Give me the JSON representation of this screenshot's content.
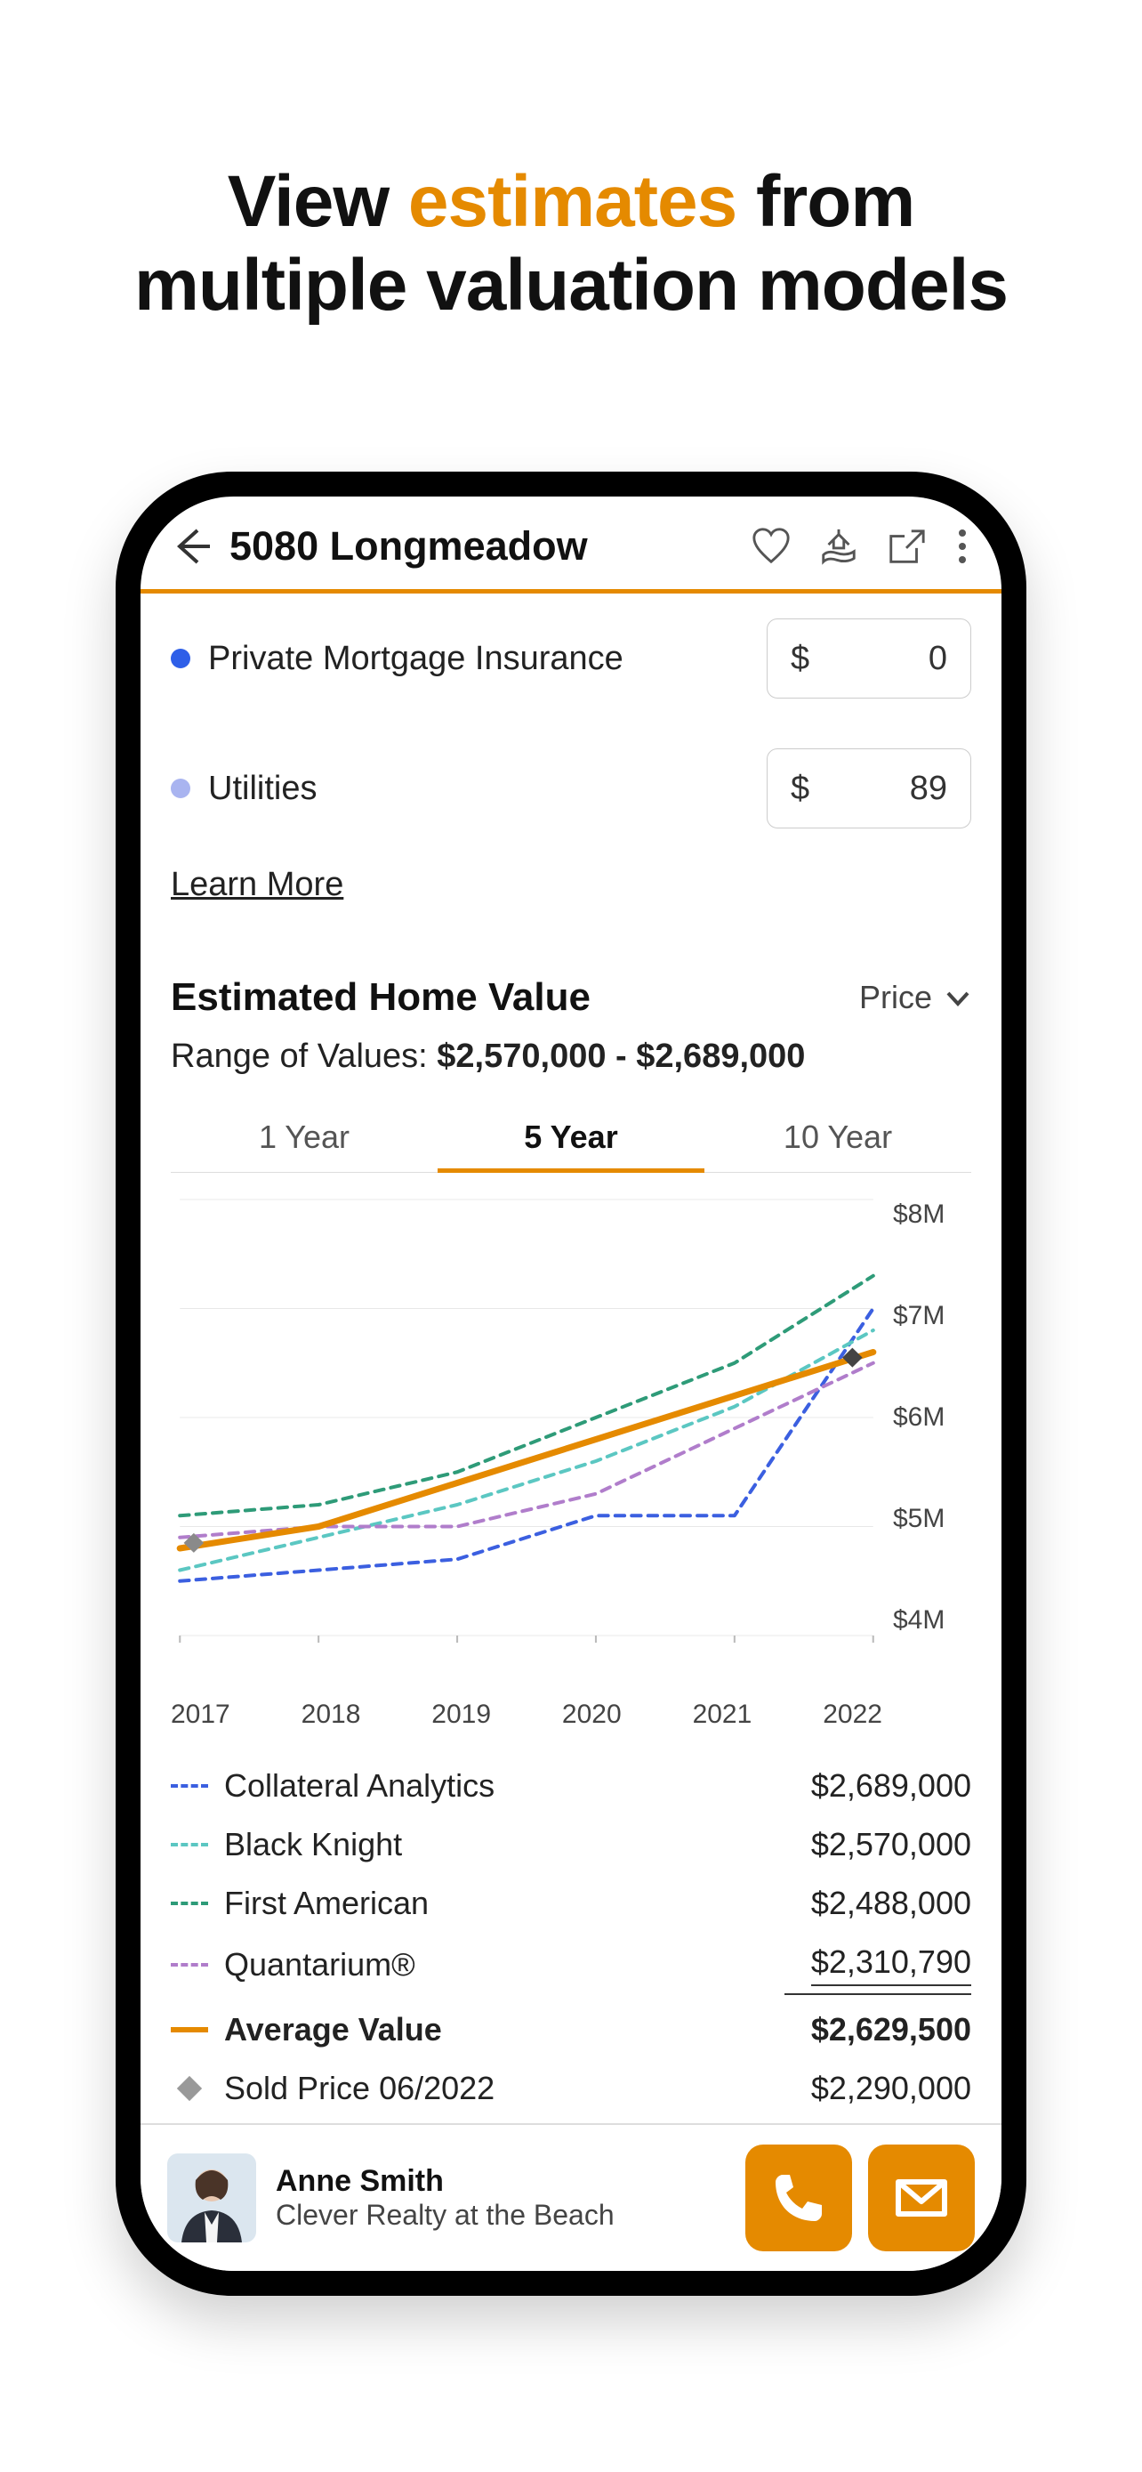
{
  "headline": {
    "pre": "View ",
    "accent": "estimates ",
    "post1": "from",
    "post2": "multiple valuation models"
  },
  "header": {
    "address": "5080 Longmeadow"
  },
  "costs": {
    "pmi": {
      "label": "Private Mortgage Insurance",
      "value": "0",
      "color": "#2E5FE8"
    },
    "utilities": {
      "label": "Utilities",
      "value": "89",
      "color": "#A9B4F0"
    },
    "learn_more": "Learn More",
    "currency": "$"
  },
  "section": {
    "title": "Estimated Home Value",
    "dropdown": "Price",
    "range_label": "Range of Values: ",
    "range_value": "$2,570,000 - $2,689,000"
  },
  "tabs": {
    "t1": "1 Year",
    "t5": "5 Year",
    "t10": "10 Year",
    "active": "5 Year"
  },
  "chart_data": {
    "type": "line",
    "xlabel": "",
    "ylabel": "",
    "x_ticks": [
      "2017",
      "2018",
      "2019",
      "2020",
      "2021",
      "2022"
    ],
    "y_ticks": [
      "$8M",
      "$7M",
      "$6M",
      "$5M",
      "$4M"
    ],
    "ylim": [
      4,
      8
    ],
    "series": [
      {
        "name": "Collateral Analytics",
        "color": "#3B5FE0",
        "style": "dashed",
        "values": [
          4.5,
          4.6,
          4.7,
          5.1,
          5.1,
          7.0
        ]
      },
      {
        "name": "Black Knight",
        "color": "#5BC7C2",
        "style": "dashed",
        "values": [
          4.6,
          4.9,
          5.2,
          5.6,
          6.1,
          6.8
        ]
      },
      {
        "name": "First American",
        "color": "#2E9B78",
        "style": "dashed",
        "values": [
          5.1,
          5.2,
          5.5,
          6.0,
          6.5,
          7.3
        ]
      },
      {
        "name": "Quantarium®",
        "color": "#B07DCB",
        "style": "dashed",
        "values": [
          4.9,
          5.0,
          5.0,
          5.3,
          5.9,
          6.5
        ]
      },
      {
        "name": "Average Value",
        "color": "#E58A00",
        "style": "solid",
        "values": [
          4.8,
          5.0,
          5.4,
          5.8,
          6.2,
          6.6
        ]
      }
    ],
    "markers": [
      {
        "name": "sold-start",
        "x": 0.1,
        "y": 4.85,
        "shape": "diamond",
        "color": "#8a8a8a"
      },
      {
        "name": "sold-end",
        "x": 4.85,
        "y": 6.55,
        "shape": "diamond",
        "color": "#444"
      }
    ]
  },
  "legend": {
    "rows": [
      {
        "name": "Collateral Analytics",
        "value": "$2,689,000",
        "style": "dashed",
        "color": "#3B5FE0"
      },
      {
        "name": "Black Knight",
        "value": "$2,570,000",
        "style": "dashed",
        "color": "#5BC7C2"
      },
      {
        "name": "First American",
        "value": "$2,488,000",
        "style": "dashed",
        "color": "#2E9B78"
      },
      {
        "name": "Quantarium®",
        "value": "$2,310,790",
        "style": "dashed",
        "color": "#B07DCB",
        "underline": true
      },
      {
        "name": "Average Value",
        "value": "$2,629,500",
        "style": "solid",
        "color": "#E58A00",
        "bold": true
      },
      {
        "name": "Sold Price 06/2022",
        "value": "$2,290,000",
        "style": "diamond",
        "color": "#999"
      }
    ]
  },
  "agent": {
    "name": "Anne Smith",
    "company": "Clever Realty at the Beach"
  }
}
